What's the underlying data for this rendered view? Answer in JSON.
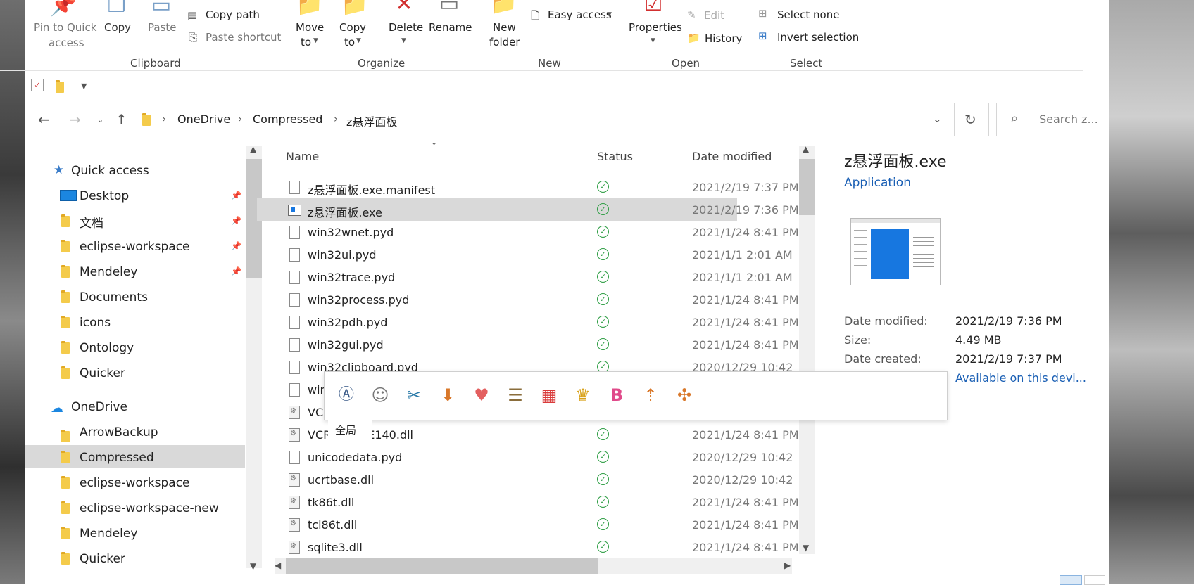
{
  "ribbon": {
    "pin_label_1": "Pin to Quick",
    "pin_label_2": "access",
    "copy": "Copy",
    "paste": "Paste",
    "copy_path": "Copy path",
    "paste_shortcut": "Paste shortcut",
    "clipboard_group": "Clipboard",
    "move_to_1": "Move",
    "move_to_2": "to",
    "copy_to_1": "Copy",
    "copy_to_2": "to",
    "delete": "Delete",
    "rename": "Rename",
    "organize_group": "Organize",
    "new_folder_1": "New",
    "new_folder_2": "folder",
    "easy_access": "Easy access",
    "new_group": "New",
    "properties": "Properties",
    "edit": "Edit",
    "history": "History",
    "open_group": "Open",
    "select_none": "Select none",
    "invert_selection": "Invert selection",
    "select_group": "Select"
  },
  "breadcrumb": [
    "OneDrive",
    "Compressed",
    "z悬浮面板"
  ],
  "search_placeholder": "Search z...",
  "columns": {
    "name": "Name",
    "status": "Status",
    "date": "Date modified"
  },
  "files": [
    {
      "name": "z悬浮面板.exe.manifest",
      "date": "2021/2/19 7:37 PM"
    },
    {
      "name": "z悬浮面板.exe",
      "date": "2021/2/19 7:36 PM"
    },
    {
      "name": "win32wnet.pyd",
      "date": "2021/1/24 8:41 PM"
    },
    {
      "name": "win32ui.pyd",
      "date": "2021/1/1 2:01 AM"
    },
    {
      "name": "win32trace.pyd",
      "date": "2021/1/1 2:01 AM"
    },
    {
      "name": "win32process.pyd",
      "date": "2021/1/24 8:41 PM"
    },
    {
      "name": "win32pdh.pyd",
      "date": "2021/1/24 8:41 PM"
    },
    {
      "name": "win32gui.pyd",
      "date": "2021/1/24 8:41 PM"
    },
    {
      "name": "win32clipboard.pyd",
      "date": "2020/12/29 10:42"
    },
    {
      "name": "win",
      "date": ""
    },
    {
      "name": "VC",
      "date": ""
    },
    {
      "name": "VCRUNTIME140.dll",
      "date": "2021/1/24 8:41 PM"
    },
    {
      "name": "unicodedata.pyd",
      "date": "2020/12/29 10:42"
    },
    {
      "name": "ucrtbase.dll",
      "date": "2020/12/29 10:42"
    },
    {
      "name": "tk86t.dll",
      "date": "2021/1/24 8:41 PM"
    },
    {
      "name": "tcl86t.dll",
      "date": "2021/1/24 8:41 PM"
    },
    {
      "name": "sqlite3.dll",
      "date": "2021/1/24 8:41 PM"
    }
  ],
  "nav": {
    "quick_access": "Quick access",
    "desktop": "Desktop",
    "docs_cn": "文档",
    "eclipse_ws": "eclipse-workspace",
    "mendeley": "Mendeley",
    "documents": "Documents",
    "icons": "icons",
    "ontology": "Ontology",
    "quicker": "Quicker",
    "onedrive": "OneDrive",
    "arrowbackup": "ArrowBackup",
    "compressed": "Compressed",
    "eclipse_ws2": "eclipse-workspace",
    "eclipse_ws_new": "eclipse-workspace-new",
    "mendeley2": "Mendeley",
    "quicker2": "Quicker"
  },
  "details": {
    "title": "z悬浮面板.exe",
    "type": "Application",
    "date_modified_label": "Date modified:",
    "date_modified": "2021/2/19 7:36 PM",
    "size_label": "Size:",
    "size": "4.49 MB",
    "date_created_label": "Date created:",
    "date_created": "2021/2/19 7:37 PM",
    "availability": "Available on this devi..."
  },
  "popup": {
    "label": "全局"
  },
  "colors": {
    "selection": "#d9d9d9",
    "status_ok": "#2e9e44",
    "accent": "#1a5fb4",
    "folder": "#f4cb4b"
  }
}
